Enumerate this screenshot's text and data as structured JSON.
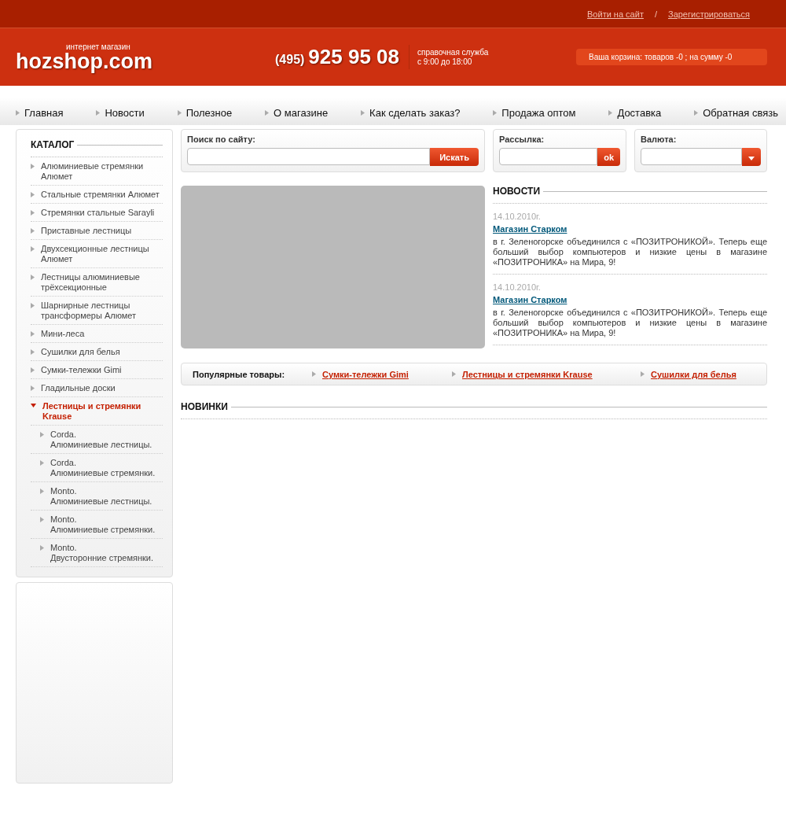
{
  "top_links": [
    {
      "label": "Войти на сайт"
    },
    {
      "label": "Зарегистрироваться"
    }
  ],
  "top_separator": "/",
  "logo": {
    "text": "hozshop.com",
    "tagline": "интернет магазин"
  },
  "phone": {
    "code": "(495)",
    "number": "925 95 08",
    "service": "справочная служба",
    "hours": "с 9:00 до 18:00"
  },
  "cart": "Ваша корзина: товаров -0 ; на сумму -0",
  "nav": [
    "Главная",
    "Новости",
    "Полезное",
    "О магазине",
    "Как сделать заказ?",
    "Продажа оптом",
    "Доставка",
    "Обратная связь"
  ],
  "catalog": {
    "title": "КАТАЛОГ",
    "items": [
      {
        "label": "Алюминиевые стремянки Алюмет",
        "selected": false
      },
      {
        "label": "Стальные стремянки Алюмет",
        "selected": false
      },
      {
        "label": "Стремянки стальные Sarayli",
        "selected": false
      },
      {
        "label": "Приставные лестницы",
        "selected": false
      },
      {
        "label": "Двухсекционные лестницы Алюмет",
        "selected": false
      },
      {
        "label": "Лестницы алюминиевые трёхсекционные",
        "selected": false
      },
      {
        "label": "Шарнирные лестницы трансформеры Алюмет",
        "selected": false
      },
      {
        "label": "Мини-леса",
        "selected": false
      },
      {
        "label": "Сушилки для белья",
        "selected": false
      },
      {
        "label": "Сумки-тележки Gimi",
        "selected": false
      },
      {
        "label": "Гладильные доски",
        "selected": false
      },
      {
        "label": "Лестницы и стремянки Krause",
        "selected": true,
        "children": [
          {
            "label": "Corda.\nАлюминиевые лестницы."
          },
          {
            "label": "Corda.\nАлюминиевые стремянки."
          },
          {
            "label": "Monto.\nАлюминиевые лестницы."
          },
          {
            "label": "Monto.\nАлюминиевые стремянки."
          },
          {
            "label": "Monto.\nДвусторонние стремянки."
          }
        ]
      }
    ]
  },
  "search": {
    "label": "Поиск по сайту:",
    "button": "Искать"
  },
  "newsletter": {
    "label": "Рассылка:",
    "button": "ok"
  },
  "currency": {
    "label": "Валюта:"
  },
  "news": {
    "title": "НОВОСТИ",
    "items": [
      {
        "date": "14.10.2010г.",
        "title": "Магазин Старком",
        "text": "в г. Зеленогорске объединился с «ПОЗИТРОНИКОЙ». Теперь еще больший выбор компьютеров и низкие цены в магазине «ПОЗИТРОНИКА» на Мира, 9!"
      },
      {
        "date": "14.10.2010г.",
        "title": "Магазин Старком",
        "text": "в г. Зеленогорске объединился с «ПОЗИТРОНИКОЙ». Теперь еще больший выбор компьютеров и низкие цены в магазине «ПОЗИТРОНИКА» на Мира, 9!"
      }
    ]
  },
  "popular": {
    "label": "Популярные товары:",
    "links": [
      "Сумки-тележки Gimi",
      "Лестницы и стремянки Krause",
      "Сушилки для белья"
    ]
  },
  "new_items": {
    "title": "НОВИНКИ"
  }
}
